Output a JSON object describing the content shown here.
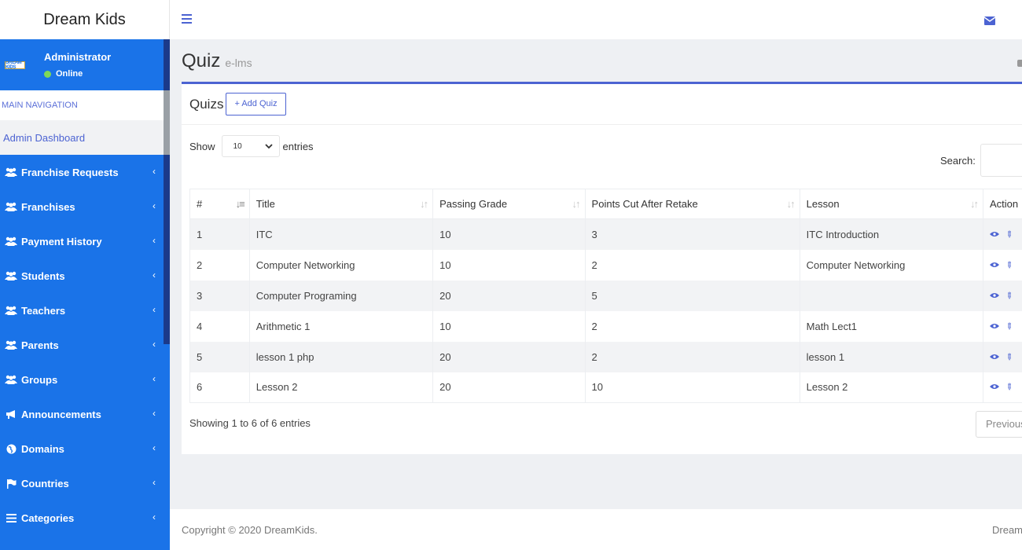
{
  "brand": "Dream Kids",
  "user": {
    "name": "Administrator",
    "status": "Online"
  },
  "nav_header": "MAIN NAVIGATION",
  "nav_active": "Admin Dashboard",
  "nav_items": [
    {
      "label": "Franchise Requests",
      "icon": "users-icon"
    },
    {
      "label": "Franchises",
      "icon": "users-icon"
    },
    {
      "label": "Payment History",
      "icon": "users-icon"
    },
    {
      "label": "Students",
      "icon": "users-icon"
    },
    {
      "label": "Teachers",
      "icon": "users-icon"
    },
    {
      "label": "Parents",
      "icon": "users-icon"
    },
    {
      "label": "Groups",
      "icon": "users-icon"
    },
    {
      "label": "Announcements",
      "icon": "bullhorn-icon"
    },
    {
      "label": "Domains",
      "icon": "globe-icon"
    },
    {
      "label": "Countries",
      "icon": "flag-icon"
    },
    {
      "label": "Categories",
      "icon": "list-icon"
    }
  ],
  "page": {
    "title": "Quiz",
    "subtitle": "e-lms"
  },
  "box": {
    "title": "Quizs",
    "add_label": "+ Add Quiz"
  },
  "length": {
    "show": "Show",
    "value": "10",
    "entries": "entries"
  },
  "search_label": "Search:",
  "table": {
    "headers": [
      "#",
      "Title",
      "Passing Grade",
      "Points Cut After Retake",
      "Lesson",
      "Action"
    ],
    "rows": [
      [
        "1",
        "ITC",
        "10",
        "3",
        "ITC Introduction"
      ],
      [
        "2",
        "Computer Networking",
        "10",
        "2",
        "Computer Networking"
      ],
      [
        "3",
        "Computer Programing",
        "20",
        "5",
        ""
      ],
      [
        "4",
        "Arithmetic 1",
        "10",
        "2",
        "Math Lect1"
      ],
      [
        "5",
        "lesson 1 php",
        "20",
        "2",
        "lesson 1"
      ],
      [
        "6",
        "Lesson 2",
        "20",
        "10",
        "Lesson 2"
      ]
    ]
  },
  "info": "Showing 1 to 6 of 6 entries",
  "prev_label": "Previous",
  "footer": {
    "copyright": "Copyright © 2020 DreamKids.",
    "right": "DreamKids"
  },
  "colors": {
    "sidebar": "#1a73e8",
    "accent": "#4c63d2",
    "online": "#7ed957"
  }
}
